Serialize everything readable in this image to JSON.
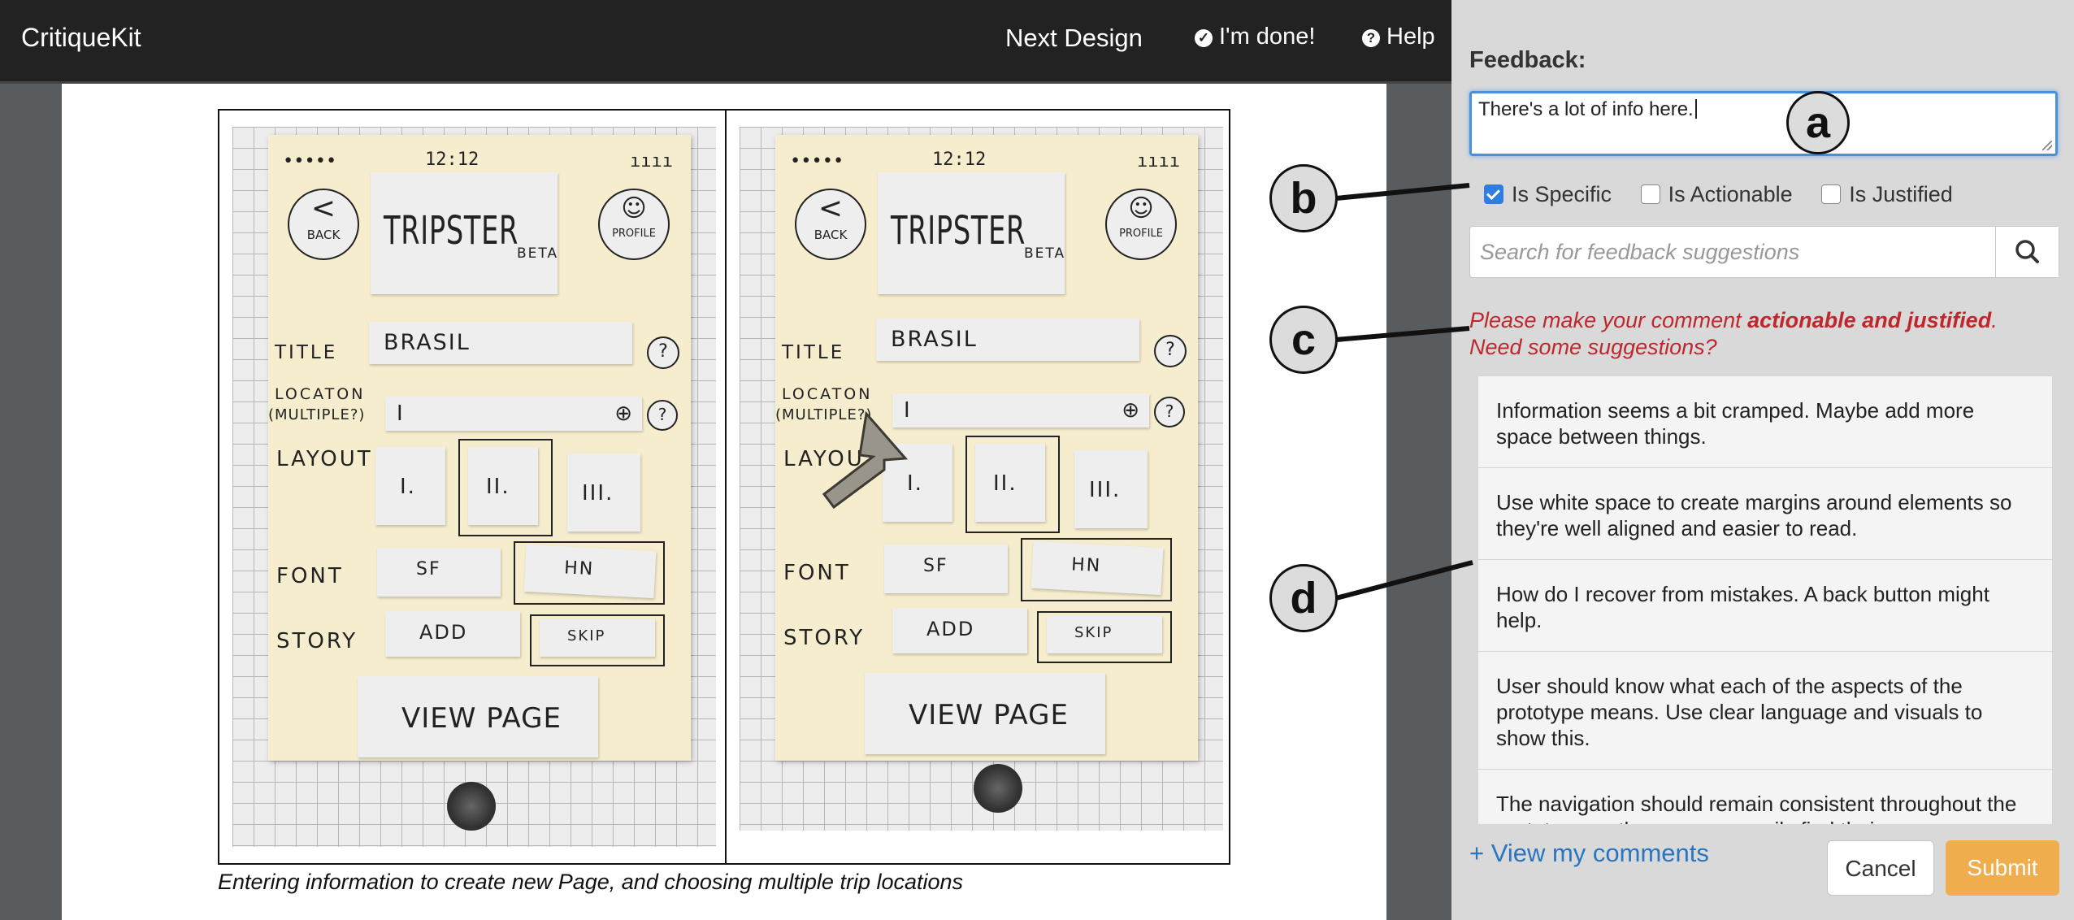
{
  "topbar": {
    "brand": "CritiqueKit",
    "next_design": "Next Design",
    "done": "I'm done!",
    "help": "Help"
  },
  "figure": {
    "caption": "Entering information to create new Page, and choosing multiple trip locations",
    "sketch": {
      "status_dots": "•••••",
      "status_time": "12:12",
      "status_bars": "ıııı",
      "back_label": "BACK",
      "app_title": "TRIPSTER",
      "beta": "BETA",
      "profile_label": "PROFILE",
      "title_label": "TITLE",
      "title_value": "BRASIL",
      "location_label": "LOCATON",
      "location_sub": "(MULTIPLE?)",
      "location_value": "I",
      "help_mark": "?",
      "layout_label": "LAYOUT",
      "layout_options": [
        "I.",
        "II.",
        "III."
      ],
      "font_label": "FONT",
      "font_options": [
        "SF",
        "HN"
      ],
      "story_label": "STORY",
      "story_options": [
        "ADD",
        "SKIP"
      ],
      "view_page": "VIEW PAGE"
    }
  },
  "panel": {
    "feedback_label": "Feedback:",
    "feedback_text": "There's a lot of info here.",
    "checkboxes": [
      {
        "label": "Is Specific",
        "checked": true
      },
      {
        "label": "Is Actionable",
        "checked": false
      },
      {
        "label": "Is Justified",
        "checked": false
      }
    ],
    "search_placeholder": "Search for feedback suggestions",
    "prompt_prefix": "Please make your comment ",
    "prompt_bold": "actionable and justified",
    "prompt_suffix": ".",
    "prompt_line2": "Need some suggestions?",
    "suggestions": [
      "Information seems a bit cramped. Maybe add more space between things.",
      "Use white space to create margins around elements so they're well aligned and easier to read.",
      "How do I recover from mistakes. A back button might help.",
      "User should know what each of the aspects of the prototype means. Use clear language and visuals to show this.",
      "The navigation should remain consistent throughout the prototype so the user can easily find their way."
    ],
    "view_comments": "+ View my comments",
    "cancel": "Cancel",
    "submit": "Submit",
    "accent_color": "#2f7de1",
    "warning_color": "#c0272d",
    "submit_color": "#f0ad4e"
  },
  "callouts": [
    "a",
    "b",
    "c",
    "d"
  ],
  "icons": {
    "done": "check-circle-icon",
    "help": "question-circle-icon",
    "search": "search-icon"
  }
}
